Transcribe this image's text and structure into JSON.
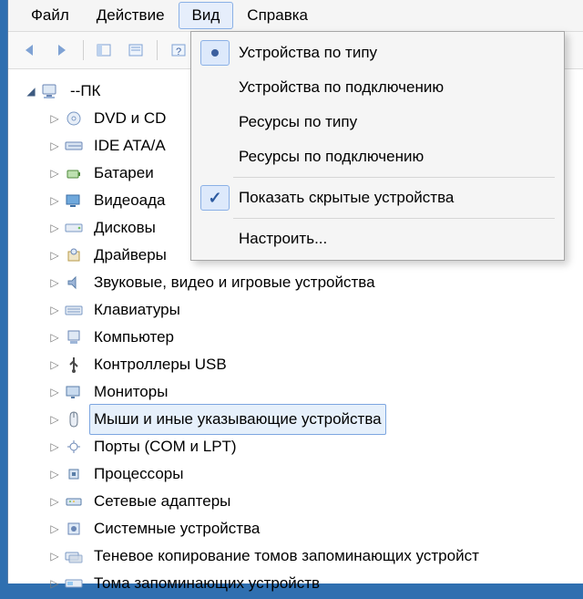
{
  "menubar": {
    "items": [
      "Файл",
      "Действие",
      "Вид",
      "Справка"
    ],
    "open_index": 2
  },
  "tree": {
    "root": "--ПК",
    "children": [
      {
        "label": "DVD и CD",
        "icon": "disc"
      },
      {
        "label": "IDE ATA/A",
        "icon": "ide"
      },
      {
        "label": "Батареи",
        "icon": "battery"
      },
      {
        "label": "Видеоада",
        "icon": "display"
      },
      {
        "label": "Дисковы",
        "icon": "drive"
      },
      {
        "label": "Драйверы",
        "icon": "driver"
      },
      {
        "label": "Звуковые, видео и игровые устройства",
        "icon": "sound"
      },
      {
        "label": "Клавиатуры",
        "icon": "keyboard"
      },
      {
        "label": "Компьютер",
        "icon": "computer"
      },
      {
        "label": "Контроллеры USB",
        "icon": "usb"
      },
      {
        "label": "Мониторы",
        "icon": "monitor"
      },
      {
        "label": "Мыши и иные указывающие устройства",
        "icon": "mouse",
        "selected": true
      },
      {
        "label": "Порты (COM и LPT)",
        "icon": "port"
      },
      {
        "label": "Процессоры",
        "icon": "cpu"
      },
      {
        "label": "Сетевые адаптеры",
        "icon": "network"
      },
      {
        "label": "Системные устройства",
        "icon": "system"
      },
      {
        "label": "Теневое копирование томов запоминающих устройст",
        "icon": "shadow"
      },
      {
        "label": "Тома запоминающих устройств",
        "icon": "volume"
      }
    ]
  },
  "dropdown": {
    "groups": [
      [
        {
          "label": "Устройства по типу",
          "mark": "radio"
        },
        {
          "label": "Устройства по подключению"
        },
        {
          "label": "Ресурсы по типу"
        },
        {
          "label": "Ресурсы по подключению"
        }
      ],
      [
        {
          "label": "Показать скрытые устройства",
          "mark": "check"
        }
      ],
      [
        {
          "label": "Настроить..."
        }
      ]
    ]
  }
}
